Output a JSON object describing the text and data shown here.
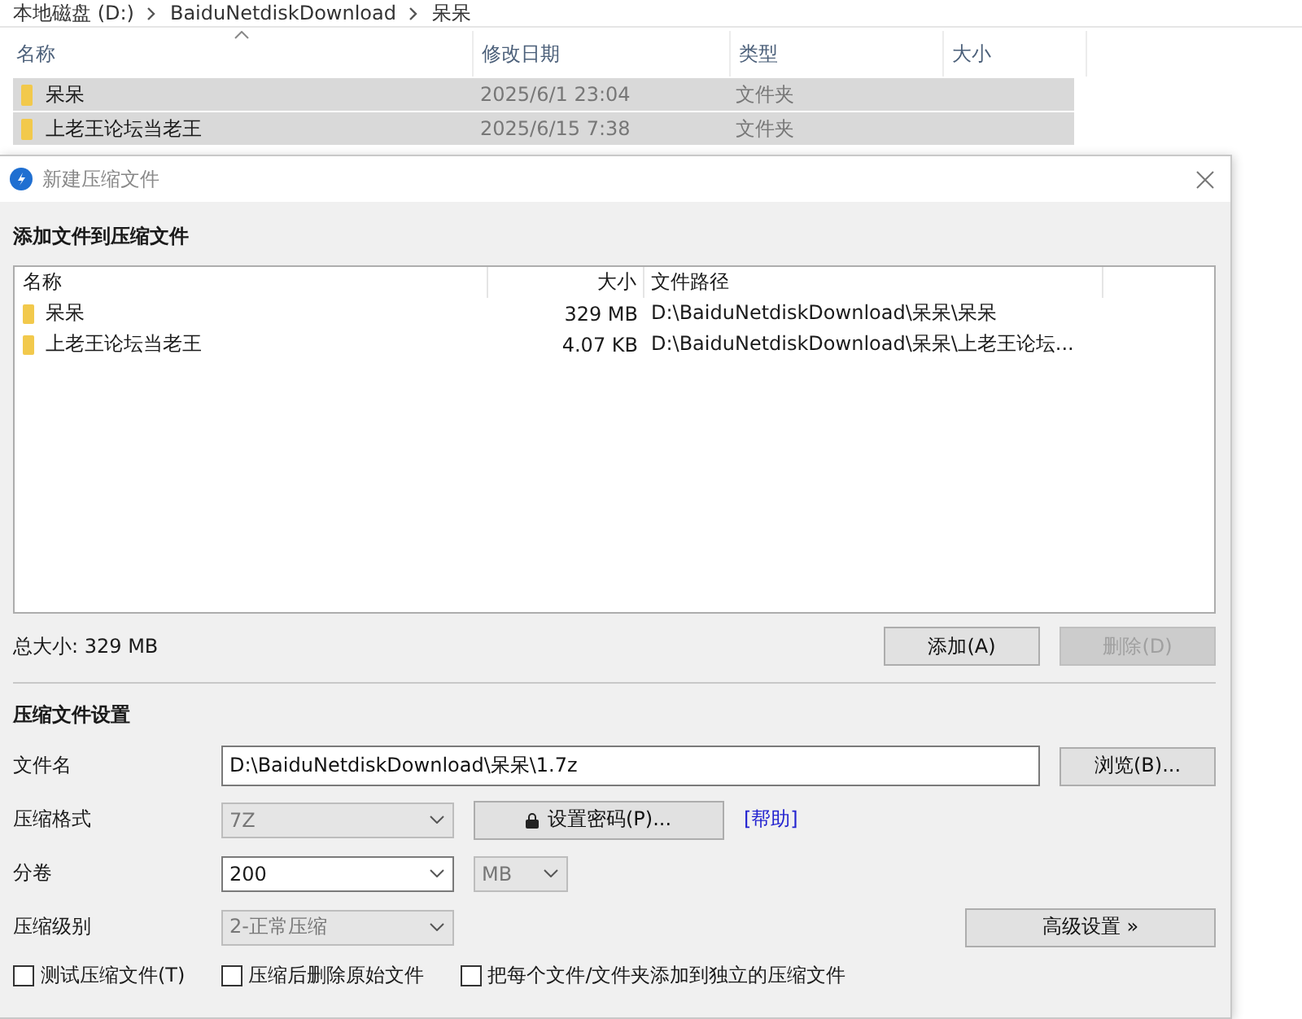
{
  "explorer": {
    "breadcrumb": [
      "本地磁盘 (D:)",
      "BaiduNetdiskDownload",
      "呆呆"
    ],
    "columns": [
      {
        "label": "名称",
        "sorted": true
      },
      {
        "label": "修改日期",
        "sorted": false
      },
      {
        "label": "类型",
        "sorted": false
      },
      {
        "label": "大小",
        "sorted": false
      }
    ],
    "rows": [
      {
        "name": "呆呆",
        "date": "2025/6/1 23:04",
        "type": "文件夹",
        "selected": true
      },
      {
        "name": "上老王论坛当老王",
        "date": "2025/6/15 7:38",
        "type": "文件夹",
        "selected": true
      }
    ]
  },
  "dialog": {
    "title": "新建压缩文件",
    "files_heading": "添加文件到压缩文件",
    "file_list": {
      "columns": [
        "名称",
        "大小",
        "文件路径"
      ],
      "rows": [
        {
          "name": "呆呆",
          "size": "329 MB",
          "path": "D:\\BaiduNetdiskDownload\\呆呆\\呆呆"
        },
        {
          "name": "上老王论坛当老王",
          "size": "4.07 KB",
          "path": "D:\\BaiduNetdiskDownload\\呆呆\\上老王论坛..."
        }
      ]
    },
    "total_size": "总大小: 329 MB",
    "list_buttons": [
      {
        "label": "添加(A)",
        "disabled": false
      },
      {
        "label": "删除(D)",
        "disabled": true
      }
    ],
    "settings_heading": "压缩文件设置",
    "filename": {
      "label": "文件名",
      "value": "D:\\BaiduNetdiskDownload\\呆呆\\1.7z",
      "button": "浏览(B)..."
    },
    "format": {
      "label": "压缩格式",
      "value": "7Z",
      "password_button": "设置密码(P)...",
      "help_link": "[帮助]"
    },
    "volume": {
      "label": "分卷",
      "value": "200",
      "unit": "MB"
    },
    "level": {
      "label": "压缩级别",
      "value": "2-正常压缩",
      "advanced_button": "高级设置 »"
    },
    "options": [
      {
        "label": "测试压缩文件(T)",
        "checked": false
      },
      {
        "label": "压缩后删除原始文件",
        "checked": false
      },
      {
        "label": "把每个文件/文件夹添加到独立的压缩文件",
        "checked": false
      }
    ]
  }
}
